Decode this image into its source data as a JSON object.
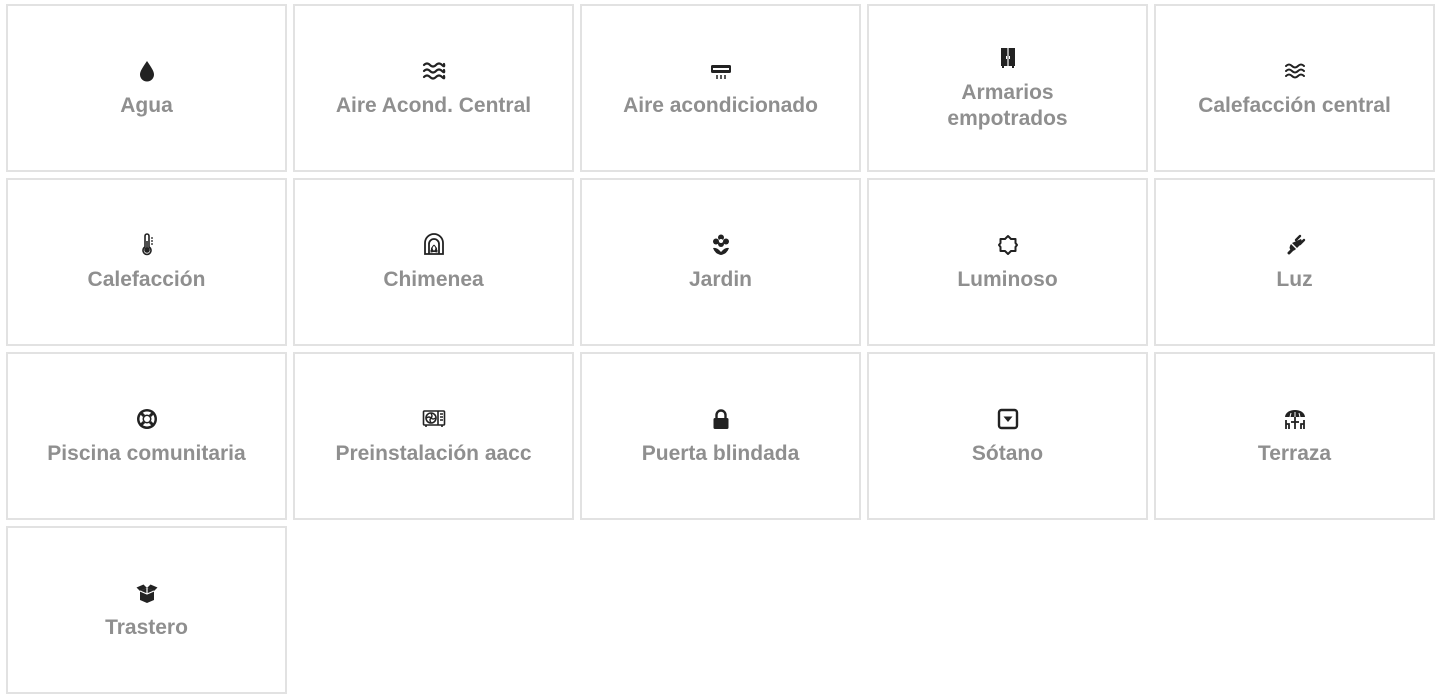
{
  "features": [
    {
      "label": "Agua",
      "icon": "water-drop-icon"
    },
    {
      "label": "Aire Acond. Central",
      "icon": "wind-waves-icon"
    },
    {
      "label": "Aire acondicionado",
      "icon": "air-conditioner-icon"
    },
    {
      "label": "Armarios empotrados",
      "icon": "wardrobe-icon"
    },
    {
      "label": "Calefacción central",
      "icon": "heat-waves-icon"
    },
    {
      "label": "Calefacción",
      "icon": "thermometer-icon"
    },
    {
      "label": "Chimenea",
      "icon": "fireplace-icon"
    },
    {
      "label": "Jardin",
      "icon": "flower-icon"
    },
    {
      "label": "Luminoso",
      "icon": "sun-icon"
    },
    {
      "label": "Luz",
      "icon": "plug-icon"
    },
    {
      "label": "Piscina comunitaria",
      "icon": "life-ring-icon"
    },
    {
      "label": "Preinstalación aacc",
      "icon": "ac-unit-icon"
    },
    {
      "label": "Puerta blindada",
      "icon": "lock-icon"
    },
    {
      "label": "Sótano",
      "icon": "caret-square-down-icon"
    },
    {
      "label": "Terraza",
      "icon": "patio-umbrella-icon"
    },
    {
      "label": "Trastero",
      "icon": "open-box-icon"
    }
  ],
  "colors": {
    "label": "#8f8f8f",
    "icon": "#222222",
    "border": "#e2e2e2"
  }
}
